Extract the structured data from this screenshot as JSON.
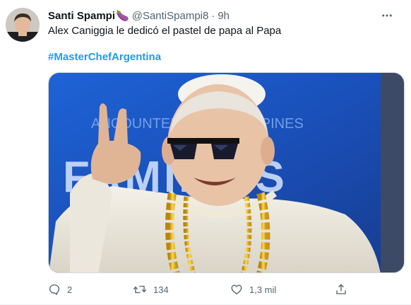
{
  "author": {
    "display_name": "Santi Spampi",
    "name_emoji": "🍆",
    "handle": "@SantiSpampi8",
    "separator": "·",
    "time": "9h"
  },
  "tweet": {
    "text": "Alex Caniggia le dedicó el pastel de papa al Papa",
    "hashtag": "#MasterChefArgentina"
  },
  "media": {
    "banner_text_top": "ANCOUNTER THE PHILIPPINES",
    "banner_text_main": "FAMILIES"
  },
  "actions": {
    "reply_count": "2",
    "retweet_count": "134",
    "like_count": "1,3 mil"
  },
  "colors": {
    "accent": "#1d9bf0",
    "secondary_text": "#536471",
    "banner_blue": "#1b56c4"
  },
  "icons": {
    "more": "more-icon",
    "reply": "reply-icon",
    "retweet": "retweet-icon",
    "like": "like-icon",
    "share": "share-icon"
  }
}
